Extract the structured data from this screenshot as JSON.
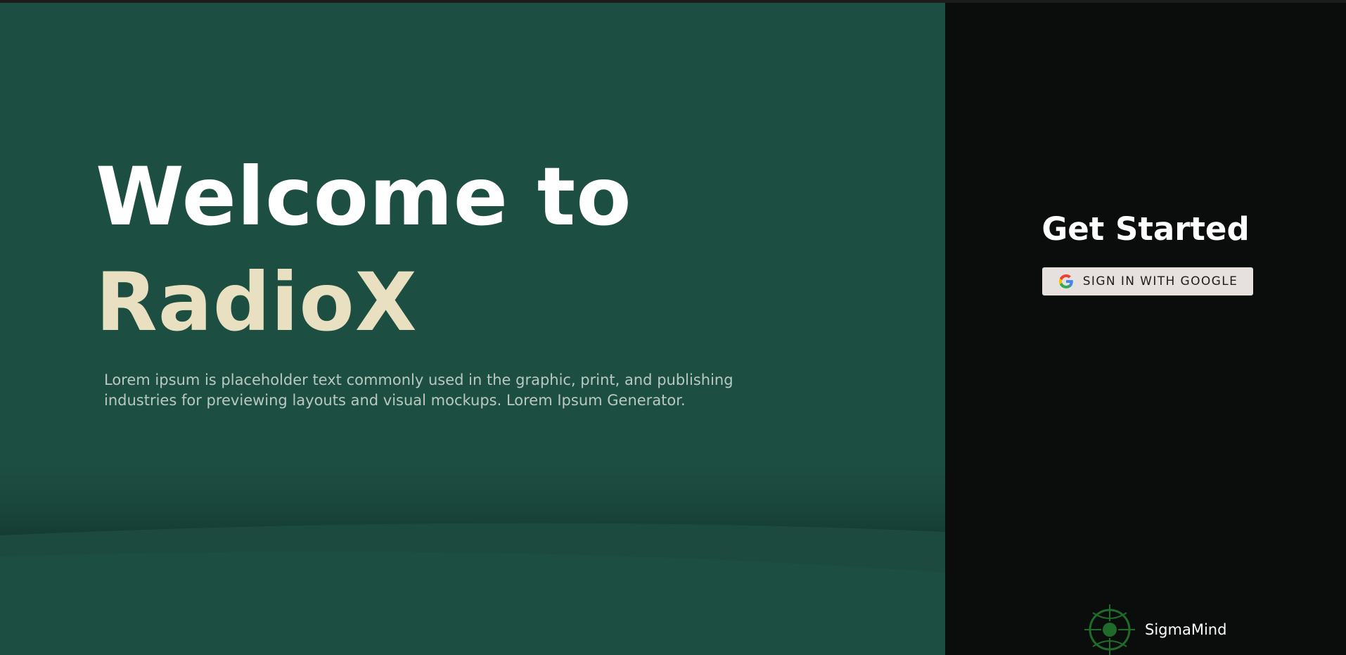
{
  "hero": {
    "title_line1": "Welcome to",
    "title_line2": "RadioX",
    "description": "Lorem ipsum is placeholder text commonly used in the graphic, print, and publishing industries for previewing layouts and visual mockups. Lorem Ipsum Generator."
  },
  "auth": {
    "heading": "Get Started",
    "google_button_label": "SIGN IN WITH GOOGLE",
    "google_icon": "google-g-icon"
  },
  "brand": {
    "name": "SigmaMind",
    "logo_icon": "sigmamind-logo-icon"
  },
  "colors": {
    "left_panel_bg": "#1c4e41",
    "right_panel_bg": "#0b0d0c",
    "title_white": "#ffffff",
    "title_accent": "#e8e0c0",
    "description_text": "#b9c9c1",
    "button_bg": "#e6e1df",
    "logo_green": "#1f6b2a"
  }
}
